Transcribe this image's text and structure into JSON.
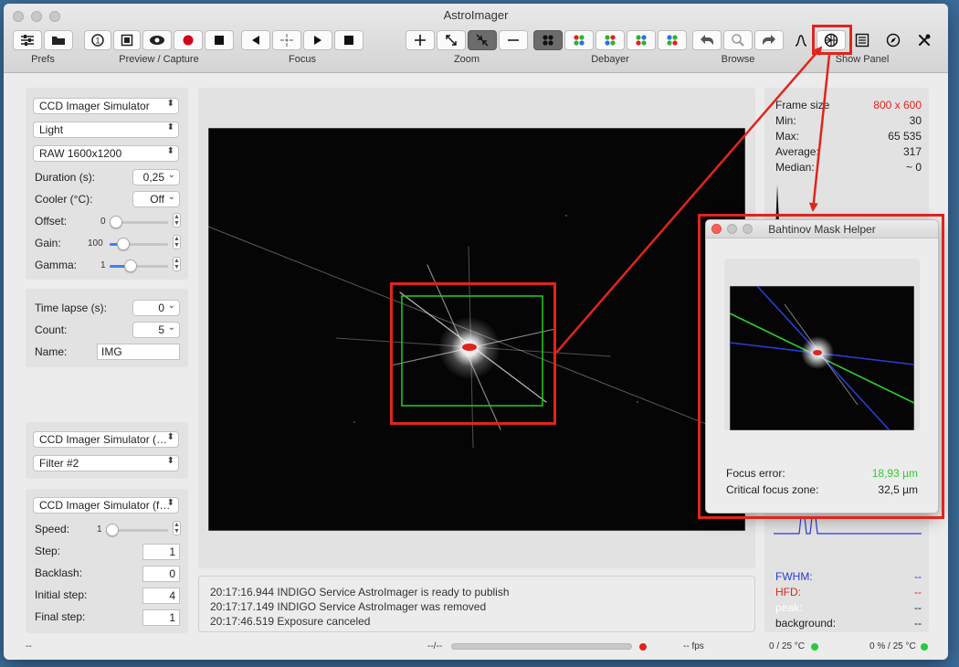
{
  "window": {
    "title": "AstroImager"
  },
  "toolbar": {
    "groups": {
      "prefs": "Prefs",
      "preview_capture": "Preview / Capture",
      "focus": "Focus",
      "zoom": "Zoom",
      "debayer": "Debayer",
      "browse": "Browse",
      "show_panel": "Show Panel"
    }
  },
  "camera": {
    "device": "CCD Imager Simulator",
    "frame_type": "Light",
    "mode": "RAW 1600x1200",
    "duration_label": "Duration (s):",
    "duration": "0,25",
    "cooler_label": "Cooler (°C):",
    "cooler": "Off",
    "offset_label": "Offset:",
    "offset": "0",
    "gain_label": "Gain:",
    "gain": "100",
    "gamma_label": "Gamma:",
    "gamma": "1"
  },
  "batch": {
    "timelapse_label": "Time lapse (s):",
    "timelapse": "0",
    "count_label": "Count:",
    "count": "5",
    "name_label": "Name:",
    "name": "IMG"
  },
  "wheel": {
    "device": "CCD Imager Simulator (…",
    "filter": "Filter #2"
  },
  "focuser": {
    "device": "CCD Imager Simulator (f…",
    "speed_label": "Speed:",
    "speed": "1",
    "step_label": "Step:",
    "step": "1",
    "backlash_label": "Backlash:",
    "backlash": "0",
    "initial_step_label": "Initial step:",
    "initial_step": "4",
    "final_step_label": "Final step:",
    "final_step": "1"
  },
  "log": [
    "20:17:16.944 INDIGO Service AstroImager is ready to publish",
    "20:17:17.149 INDIGO Service AstroImager was removed",
    "20:17:46.519 Exposure canceled"
  ],
  "stats": {
    "frame_size_label": "Frame size",
    "frame_size": "800 x 600",
    "min_label": "Min:",
    "min": "30",
    "max_label": "Max:",
    "max": "65 535",
    "average_label": "Average:",
    "average": "317",
    "median_label": "Median:",
    "median": "~ 0"
  },
  "metrics": {
    "fwhm_label": "FWHM:",
    "fwhm": "--",
    "hfd_label": "HFD:",
    "hfd": "--",
    "peak_label": "peak:",
    "peak": "--",
    "background_label": "background:",
    "background": "--"
  },
  "bahtinov": {
    "title": "Bahtinov Mask Helper",
    "focus_error_label": "Focus error:",
    "focus_error": "18,93 µm",
    "critical_zone_label": "Critical focus zone:",
    "critical_zone": "32,5 µm"
  },
  "status": {
    "left": "--",
    "progress_text": "--/--",
    "fps": "-- fps",
    "cooler": "0 / 25 °C",
    "focuser": "0 % / 25 °C"
  },
  "colors": {
    "annotation_red": "#e0241d",
    "focus_error_green": "#33cc33",
    "fwhm_blue": "#2a3cd6",
    "hfd_red": "#e0241d"
  }
}
